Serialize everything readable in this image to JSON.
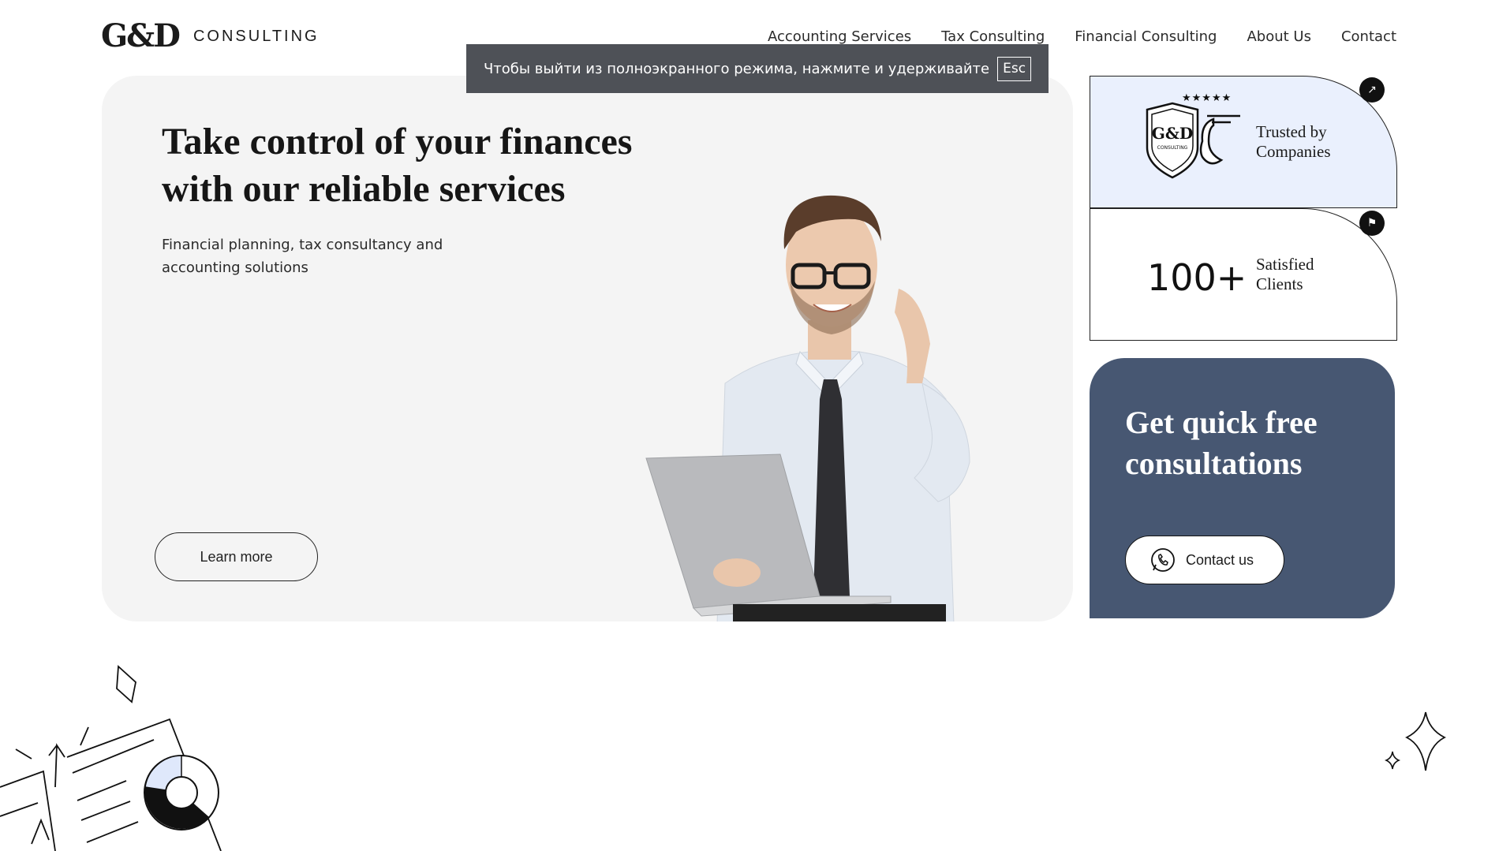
{
  "header": {
    "logo_mark": "G&D",
    "logo_text": "CONSULTING",
    "nav": [
      "Accounting Services",
      "Tax Consulting",
      "Financial Consulting",
      "About Us",
      "Contact"
    ]
  },
  "overlay": {
    "message": "Чтобы выйти из полноэкранного режима, нажмите и удерживайте",
    "key": "Esc"
  },
  "hero": {
    "title": "Take control of your finances with our reliable services",
    "subtitle": "Financial planning, tax consultancy and accounting solutions",
    "button": "Learn more"
  },
  "cards": {
    "trust": {
      "stars": "★★★★★",
      "badge_mark": "G&D",
      "badge_text": "CONSULTING",
      "label": "Trusted by Companies"
    },
    "clients": {
      "number": "100+",
      "label": "Satisfied Clients"
    },
    "consult": {
      "title": "Get quick free consultations",
      "button": "Contact us"
    }
  },
  "colors": {
    "consult_bg": "#475772",
    "trust_bg": "#eaf0fd",
    "hero_bg": "#f4f4f4"
  }
}
